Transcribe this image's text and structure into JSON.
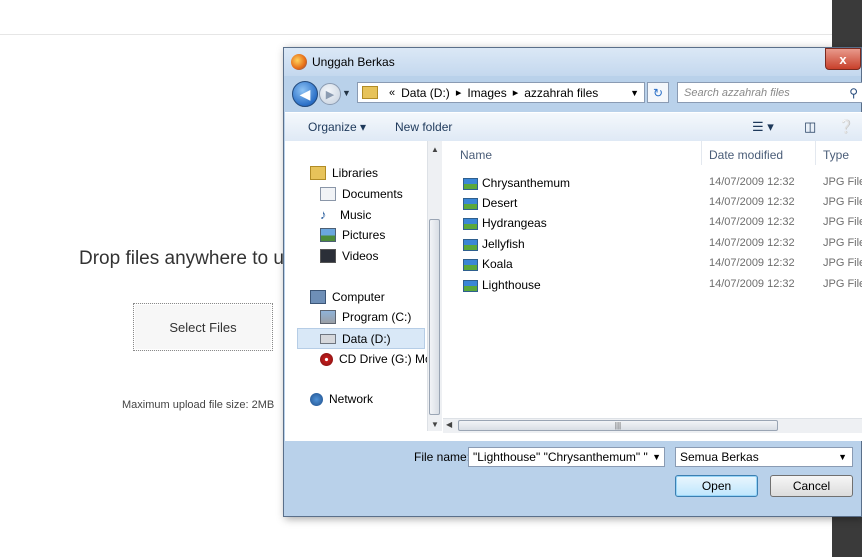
{
  "page": {
    "drop_text": "Drop files anywhere to u",
    "select_button": "Select Files",
    "max_size": "Maximum upload file size: 2MB"
  },
  "dialog": {
    "title": "Unggah Berkas",
    "close": "x",
    "breadcrumb": [
      "Data (D:)",
      "Images",
      "azzahrah files"
    ],
    "search_placeholder": "Search azzahrah files",
    "toolbar": {
      "organize": "Organize ▾",
      "new_folder": "New folder"
    },
    "nav": {
      "libraries": "Libraries",
      "documents": "Documents",
      "music": "Music",
      "pictures": "Pictures",
      "videos": "Videos",
      "computer": "Computer",
      "program_c": "Program (C:)",
      "data_d": "Data (D:)",
      "cd_drive": "CD Drive (G:) Mo",
      "network": "Network"
    },
    "columns": {
      "name": "Name",
      "date": "Date modified",
      "type": "Type"
    },
    "files": [
      {
        "name": "Chrysanthemum",
        "date": "14/07/2009 12:32",
        "type": "JPG File"
      },
      {
        "name": "Desert",
        "date": "14/07/2009 12:32",
        "type": "JPG File"
      },
      {
        "name": "Hydrangeas",
        "date": "14/07/2009 12:32",
        "type": "JPG File"
      },
      {
        "name": "Jellyfish",
        "date": "14/07/2009 12:32",
        "type": "JPG File"
      },
      {
        "name": "Koala",
        "date": "14/07/2009 12:32",
        "type": "JPG File"
      },
      {
        "name": "Lighthouse",
        "date": "14/07/2009 12:32",
        "type": "JPG File"
      }
    ],
    "file_name_label": "File name:",
    "file_name_value": "\"Lighthouse\" \"Chrysanthemum\" \"",
    "filter": "Semua Berkas",
    "open": "Open",
    "cancel": "Cancel"
  }
}
